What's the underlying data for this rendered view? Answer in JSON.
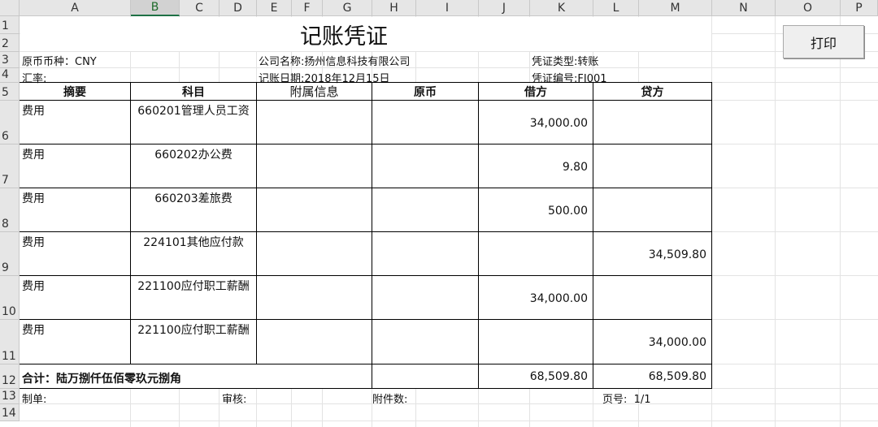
{
  "columns": [
    "A",
    "B",
    "C",
    "D",
    "E",
    "F",
    "G",
    "H",
    "I",
    "J",
    "K",
    "L",
    "M",
    "N",
    "O",
    "P"
  ],
  "rows": [
    "1",
    "2",
    "3",
    "4",
    "5",
    "6",
    "7",
    "8",
    "9",
    "10",
    "11",
    "12",
    "13",
    "14"
  ],
  "title": "记账凭证",
  "print_button": "打印",
  "info": {
    "currency": "原币币种：CNY",
    "rate": "汇率:",
    "company": "公司名称:扬州信息科技有限公司",
    "date": "记账日期:2018年12月15日",
    "voucher_type": "凭证类型:转账",
    "voucher_no": "凭证编号:FI001"
  },
  "table": {
    "headers": [
      "摘要",
      "科目",
      "附属信息",
      "原币",
      "借方",
      "贷方"
    ],
    "rows": [
      {
        "summary": "费用",
        "account": "660201管理人员工资",
        "debit": "34,000.00",
        "credit": ""
      },
      {
        "summary": "费用",
        "account": "660202办公费",
        "debit": "9.80",
        "credit": ""
      },
      {
        "summary": "费用",
        "account": "660203差旅费",
        "debit": "500.00",
        "credit": ""
      },
      {
        "summary": "费用",
        "account": "224101其他应付款",
        "debit": "",
        "credit": "34,509.80"
      },
      {
        "summary": "费用",
        "account": "221100应付职工薪酬",
        "debit": "34,000.00",
        "credit": ""
      },
      {
        "summary": "费用",
        "account": "221100应付职工薪酬",
        "debit": "",
        "credit": "34,000.00"
      }
    ],
    "total_label": "合计：陆万捌仟伍佰零玖元捌角",
    "total_debit": "68,509.80",
    "total_credit": "68,509.80"
  },
  "footer": {
    "maker": "制单:",
    "auditor": "审核:",
    "attachments": "附件数:",
    "page": "页号:  1/1"
  }
}
